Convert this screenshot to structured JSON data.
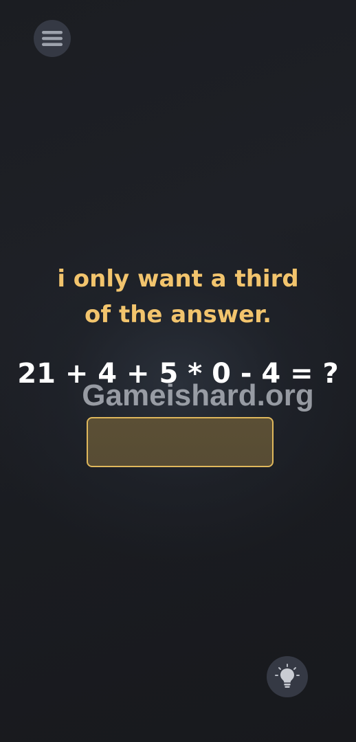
{
  "menu": {
    "icon": "menu-icon"
  },
  "riddle": {
    "line1": "i only want a third",
    "line2": "of the answer."
  },
  "equation": "21 + 4 + 5 * 0 - 4 = ?",
  "watermark": "Gameishard.org",
  "answer_input": {
    "value": "",
    "placeholder": ""
  },
  "hint": {
    "icon": "lightbulb-icon"
  },
  "colors": {
    "riddle_text": "#f2c46d",
    "equation_text": "#ffffff",
    "answer_border": "#e0b85c",
    "answer_fill": "#5b4f35",
    "button_bg": "#353944"
  }
}
